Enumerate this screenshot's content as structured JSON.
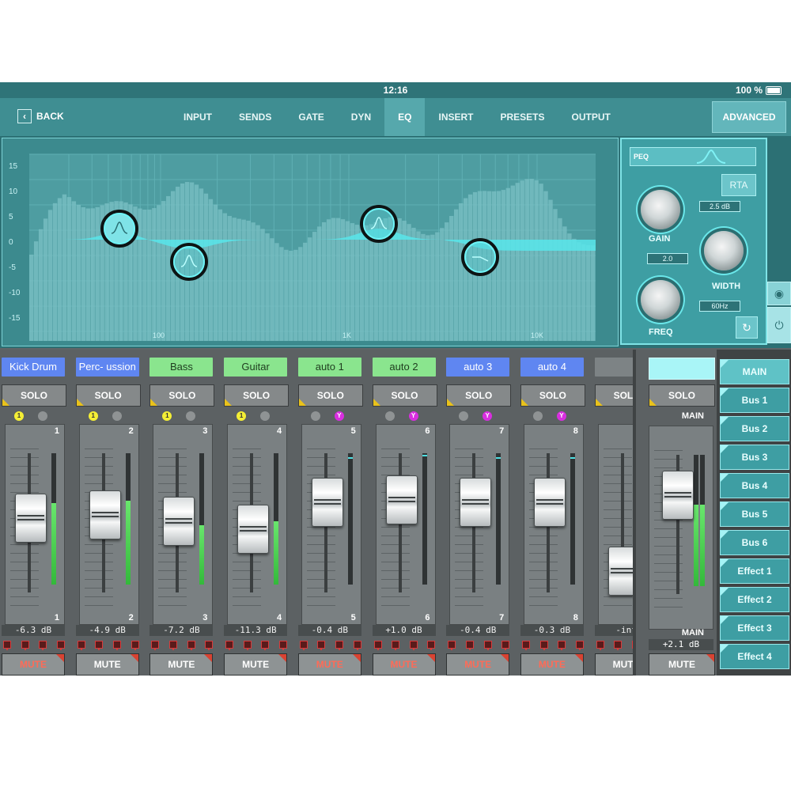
{
  "status_bar": {
    "time": "12:16",
    "battery": "100 %"
  },
  "nav": {
    "back": "BACK",
    "tabs": [
      "INPUT",
      "SENDS",
      "GATE",
      "DYN",
      "EQ",
      "INSERT",
      "PRESETS",
      "OUTPUT"
    ],
    "active_tab": "EQ",
    "advanced": "ADVANCED"
  },
  "eq": {
    "y_ticks": [
      "15",
      "10",
      "5",
      "0",
      "-5",
      "-10",
      "-15"
    ],
    "x_ticks": [
      "100",
      "1K",
      "10K"
    ],
    "mode": "PEQ",
    "rta_label": "RTA",
    "gain_label": "GAIN",
    "gain_value": "2.5 dB",
    "width_label": "WIDTH",
    "width_value": "2.0",
    "freq_label": "FREQ",
    "freq_value": "60Hz"
  },
  "channels": [
    {
      "name": "Kick Drum",
      "color": "blue",
      "number": "1",
      "db": "-6.3 dB",
      "solo": "SOLO",
      "mute": "MUTE",
      "mute_active": true,
      "ind1": "yellow",
      "ind2": "grey",
      "fader": 0.55,
      "meter": 0.62
    },
    {
      "name": "Perc- ussion",
      "color": "blue",
      "number": "2",
      "db": "-4.9 dB",
      "solo": "SOLO",
      "mute": "MUTE",
      "mute_active": false,
      "ind1": "yellow",
      "ind2": "grey",
      "fader": 0.58,
      "meter": 0.64
    },
    {
      "name": "Bass",
      "color": "green",
      "number": "3",
      "db": "-7.2 dB",
      "solo": "SOLO",
      "mute": "MUTE",
      "mute_active": false,
      "ind1": "yellow",
      "ind2": "grey",
      "fader": 0.52,
      "meter": 0.45
    },
    {
      "name": "Guitar",
      "color": "green",
      "number": "4",
      "db": "-11.3 dB",
      "solo": "SOLO",
      "mute": "MUTE",
      "mute_active": false,
      "ind1": "yellow",
      "ind2": "grey",
      "fader": 0.45,
      "meter": 0.48
    },
    {
      "name": "auto 1",
      "color": "green",
      "number": "5",
      "db": "-0.4 dB",
      "solo": "SOLO",
      "mute": "MUTE",
      "mute_active": true,
      "ind1": "grey",
      "ind2": "magenta",
      "fader": 0.7,
      "meter": 0.0,
      "peak": 0.97
    },
    {
      "name": "auto 2",
      "color": "green",
      "number": "6",
      "db": "+1.0 dB",
      "solo": "SOLO",
      "mute": "MUTE",
      "mute_active": true,
      "ind1": "grey",
      "ind2": "magenta",
      "fader": 0.72,
      "meter": 0.0,
      "peak": 0.99
    },
    {
      "name": "auto 3",
      "color": "blue",
      "number": "7",
      "db": "-0.4 dB",
      "solo": "SOLO",
      "mute": "MUTE",
      "mute_active": true,
      "ind1": "grey",
      "ind2": "magenta",
      "fader": 0.7,
      "meter": 0.0,
      "peak": 0.97
    },
    {
      "name": "auto 4",
      "color": "blue",
      "number": "8",
      "db": "-0.3 dB",
      "solo": "SOLO",
      "mute": "MUTE",
      "mute_active": true,
      "ind1": "grey",
      "ind2": "magenta",
      "fader": 0.7,
      "meter": 0.0,
      "peak": 0.97
    },
    {
      "name": "",
      "color": "blank",
      "number": "",
      "db": "-inf",
      "solo": "SOLO",
      "mute": "MUTE",
      "mute_active": false,
      "ind1": "",
      "ind2": "",
      "fader": 0.06,
      "meter": 0.0
    }
  ],
  "main": {
    "name": "",
    "solo": "SOLO",
    "label_top": "MAIN",
    "label_bottom": "MAIN",
    "db": "+2.1 dB",
    "mute": "MUTE",
    "fader": 0.78,
    "meter": 0.62
  },
  "buses": [
    "MAIN",
    "Bus 1",
    "Bus 2",
    "Bus 3",
    "Bus 4",
    "Bus 5",
    "Bus 6",
    "Effect 1",
    "Effect 2",
    "Effect 3",
    "Effect 4"
  ],
  "active_bus": "MAIN"
}
